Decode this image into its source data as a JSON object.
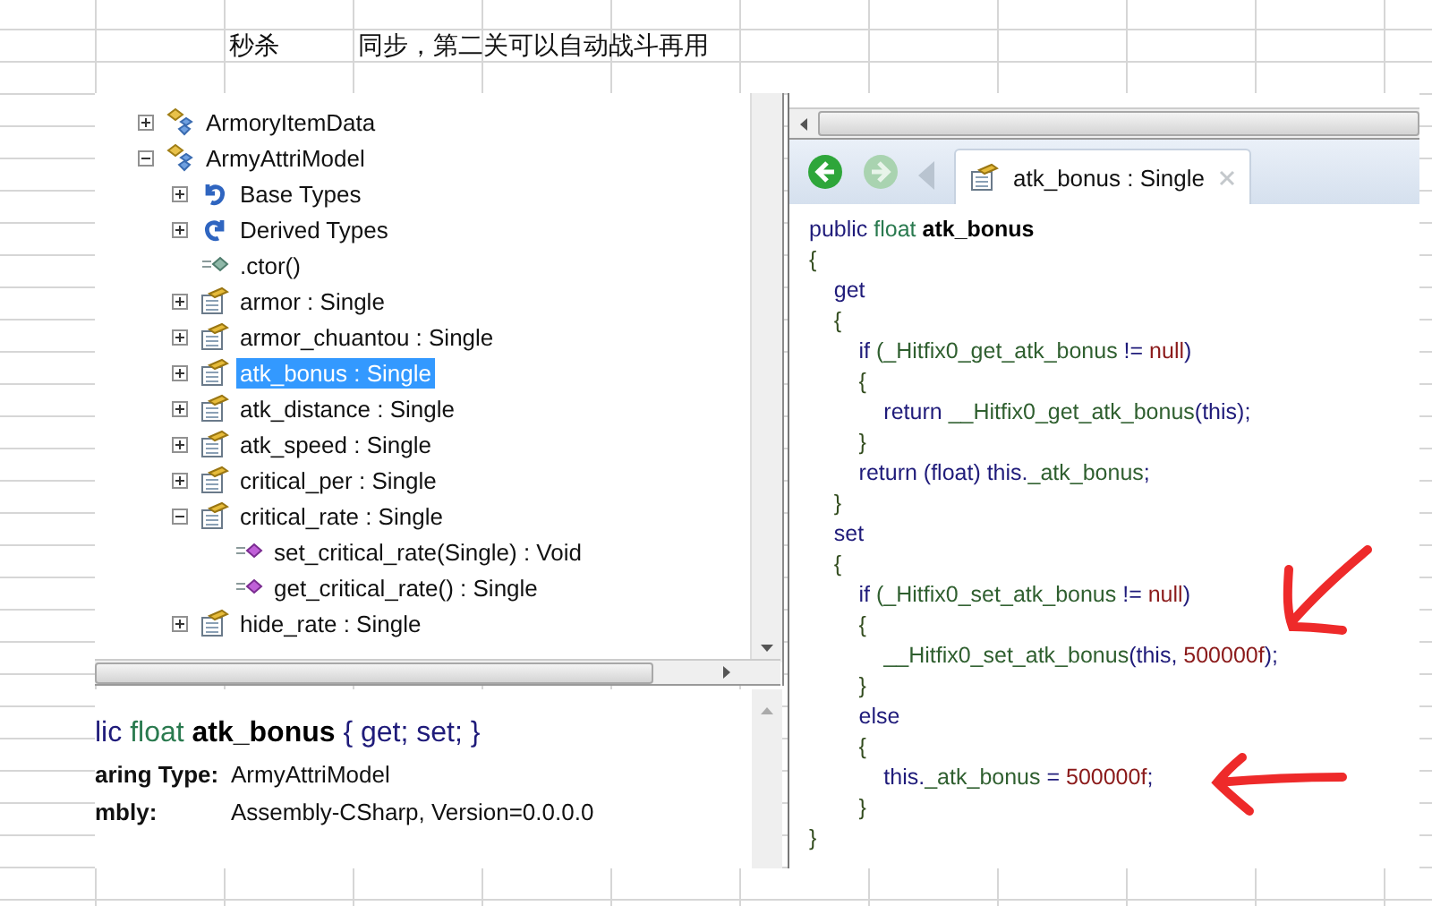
{
  "sheet": {
    "cells": [
      "秒杀",
      "同步，第二关可以自动战斗再用"
    ]
  },
  "tree": {
    "items": [
      {
        "label": "ArmoryItemData",
        "kind": "class",
        "expanded": false,
        "selected": false
      },
      {
        "label": "ArmyAttriModel",
        "kind": "class",
        "expanded": true,
        "selected": false,
        "children": [
          {
            "label": "Base Types",
            "kind": "base",
            "expanded": false,
            "selected": false
          },
          {
            "label": "Derived Types",
            "kind": "derived",
            "expanded": false,
            "selected": false
          },
          {
            "label": ".ctor()",
            "kind": "method",
            "selected": false
          },
          {
            "label": "armor : Single",
            "kind": "property",
            "expanded": false,
            "selected": false
          },
          {
            "label": "armor_chuantou : Single",
            "kind": "property",
            "expanded": false,
            "selected": false
          },
          {
            "label": "atk_bonus : Single",
            "kind": "property",
            "expanded": false,
            "selected": true
          },
          {
            "label": "atk_distance : Single",
            "kind": "property",
            "expanded": false,
            "selected": false
          },
          {
            "label": "atk_speed : Single",
            "kind": "property",
            "expanded": false,
            "selected": false
          },
          {
            "label": "critical_per : Single",
            "kind": "property",
            "expanded": false,
            "selected": false
          },
          {
            "label": "critical_rate : Single",
            "kind": "property",
            "expanded": true,
            "selected": false,
            "children": [
              {
                "label": "set_critical_rate(Single) : Void",
                "kind": "accessor",
                "selected": false
              },
              {
                "label": "get_critical_rate() : Single",
                "kind": "accessor",
                "selected": false
              }
            ]
          },
          {
            "label": "hide_rate : Single",
            "kind": "property",
            "expanded": false,
            "selected": false
          }
        ]
      }
    ]
  },
  "info": {
    "signature": [
      {
        "text": "lic ",
        "kind": "kw"
      },
      {
        "text": "float ",
        "kind": "type"
      },
      {
        "text": "atk_bonus",
        "kind": "bold"
      },
      {
        "text": " { get; set; }",
        "kind": "kw"
      }
    ],
    "rows": [
      {
        "label": "aring Type:",
        "value": "ArmyAttriModel"
      },
      {
        "label": "mbly:",
        "value": "Assembly-CSharp, Version=0.0.0.0"
      }
    ]
  },
  "editor": {
    "tab": {
      "label": "atk_bonus : Single"
    },
    "code": [
      {
        "tokens": [
          {
            "text": "public ",
            "kind": "kw"
          },
          {
            "text": "float ",
            "kind": "type"
          },
          {
            "text": "atk_bonus",
            "kind": "bold"
          }
        ]
      },
      {
        "tokens": [
          {
            "text": "{",
            "kind": "punct"
          }
        ]
      },
      {
        "tokens": [
          {
            "text": "    get",
            "kind": "kw"
          }
        ]
      },
      {
        "tokens": [
          {
            "text": "    {",
            "kind": "punct"
          }
        ]
      },
      {
        "tokens": [
          {
            "text": "        if ",
            "kind": "kw"
          },
          {
            "text": "(_Hitfix0_get_atk_bonus",
            "kind": "member"
          },
          {
            "text": " != ",
            "kind": "kw"
          },
          {
            "text": "null",
            "kind": "literal"
          },
          {
            "text": ")",
            "kind": "kw"
          }
        ]
      },
      {
        "tokens": [
          {
            "text": "        {",
            "kind": "punct"
          }
        ]
      },
      {
        "tokens": [
          {
            "text": "            return ",
            "kind": "kw"
          },
          {
            "text": "__Hitfix0_get_atk_bonus",
            "kind": "member"
          },
          {
            "text": "(this);",
            "kind": "kw"
          }
        ]
      },
      {
        "tokens": [
          {
            "text": "        }",
            "kind": "punct"
          }
        ]
      },
      {
        "tokens": [
          {
            "text": "        return (float) this.",
            "kind": "kw"
          },
          {
            "text": "_atk_bonus",
            "kind": "member"
          },
          {
            "text": ";",
            "kind": "kw"
          }
        ]
      },
      {
        "tokens": [
          {
            "text": "    }",
            "kind": "punct"
          }
        ]
      },
      {
        "tokens": [
          {
            "text": "    set",
            "kind": "kw"
          }
        ]
      },
      {
        "tokens": [
          {
            "text": "    {",
            "kind": "punct"
          }
        ]
      },
      {
        "tokens": [
          {
            "text": "        if ",
            "kind": "kw"
          },
          {
            "text": "(_Hitfix0_set_atk_bonus",
            "kind": "member"
          },
          {
            "text": " != ",
            "kind": "kw"
          },
          {
            "text": "null",
            "kind": "literal"
          },
          {
            "text": ")",
            "kind": "kw"
          }
        ]
      },
      {
        "tokens": [
          {
            "text": "        {",
            "kind": "punct"
          }
        ]
      },
      {
        "tokens": [
          {
            "text": "            __Hitfix0_set_atk_bonus",
            "kind": "member"
          },
          {
            "text": "(this, ",
            "kind": "kw"
          },
          {
            "text": "500000f",
            "kind": "literal"
          },
          {
            "text": ");",
            "kind": "kw"
          }
        ]
      },
      {
        "tokens": [
          {
            "text": "        }",
            "kind": "punct"
          }
        ]
      },
      {
        "tokens": [
          {
            "text": "        else",
            "kind": "kw"
          }
        ]
      },
      {
        "tokens": [
          {
            "text": "        {",
            "kind": "punct"
          }
        ]
      },
      {
        "tokens": [
          {
            "text": "            this.",
            "kind": "kw"
          },
          {
            "text": "_atk_bonus",
            "kind": "member"
          },
          {
            "text": " = ",
            "kind": "kw"
          },
          {
            "text": "500000f",
            "kind": "literal"
          },
          {
            "text": ";",
            "kind": "kw"
          }
        ]
      },
      {
        "tokens": [
          {
            "text": "        }",
            "kind": "punct"
          }
        ]
      },
      {
        "tokens": [
          {
            "text": "}",
            "kind": "punct"
          }
        ]
      }
    ]
  }
}
